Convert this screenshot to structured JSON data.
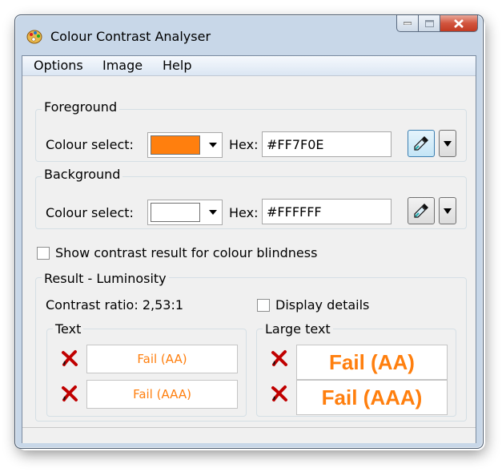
{
  "window": {
    "title": "Colour Contrast Analyser"
  },
  "menu": [
    "Options",
    "Image",
    "Help"
  ],
  "foreground": {
    "group_label": "Foreground",
    "colour_select_label": "Colour select:",
    "swatch_color": "#ff7f0e",
    "hex_label": "Hex:",
    "hex_value": "#FF7F0E",
    "picker_icon": "eyedropper-icon"
  },
  "background": {
    "group_label": "Background",
    "colour_select_label": "Colour select:",
    "swatch_color": "#ffffff",
    "hex_label": "Hex:",
    "hex_value": "#FFFFFF",
    "picker_icon": "eyedropper-icon"
  },
  "colour_blindness": {
    "label": "Show contrast result for colour blindness",
    "checked": false
  },
  "result": {
    "group_label": "Result - Luminosity",
    "contrast_ratio": "Contrast ratio: 2,53:1",
    "display_details": {
      "label": "Display details",
      "checked": false
    },
    "text": {
      "label": "Text",
      "rows": [
        {
          "status_icon": "fail-x-icon",
          "value": "Fail (AA)"
        },
        {
          "status_icon": "fail-x-icon",
          "value": "Fail (AAA)"
        }
      ]
    },
    "large_text": {
      "label": "Large text",
      "rows": [
        {
          "status_icon": "fail-x-icon",
          "value": "Fail (AA)"
        },
        {
          "status_icon": "fail-x-icon",
          "value": "Fail (AAA)"
        }
      ]
    },
    "fail_color": "#ff7f0e"
  }
}
